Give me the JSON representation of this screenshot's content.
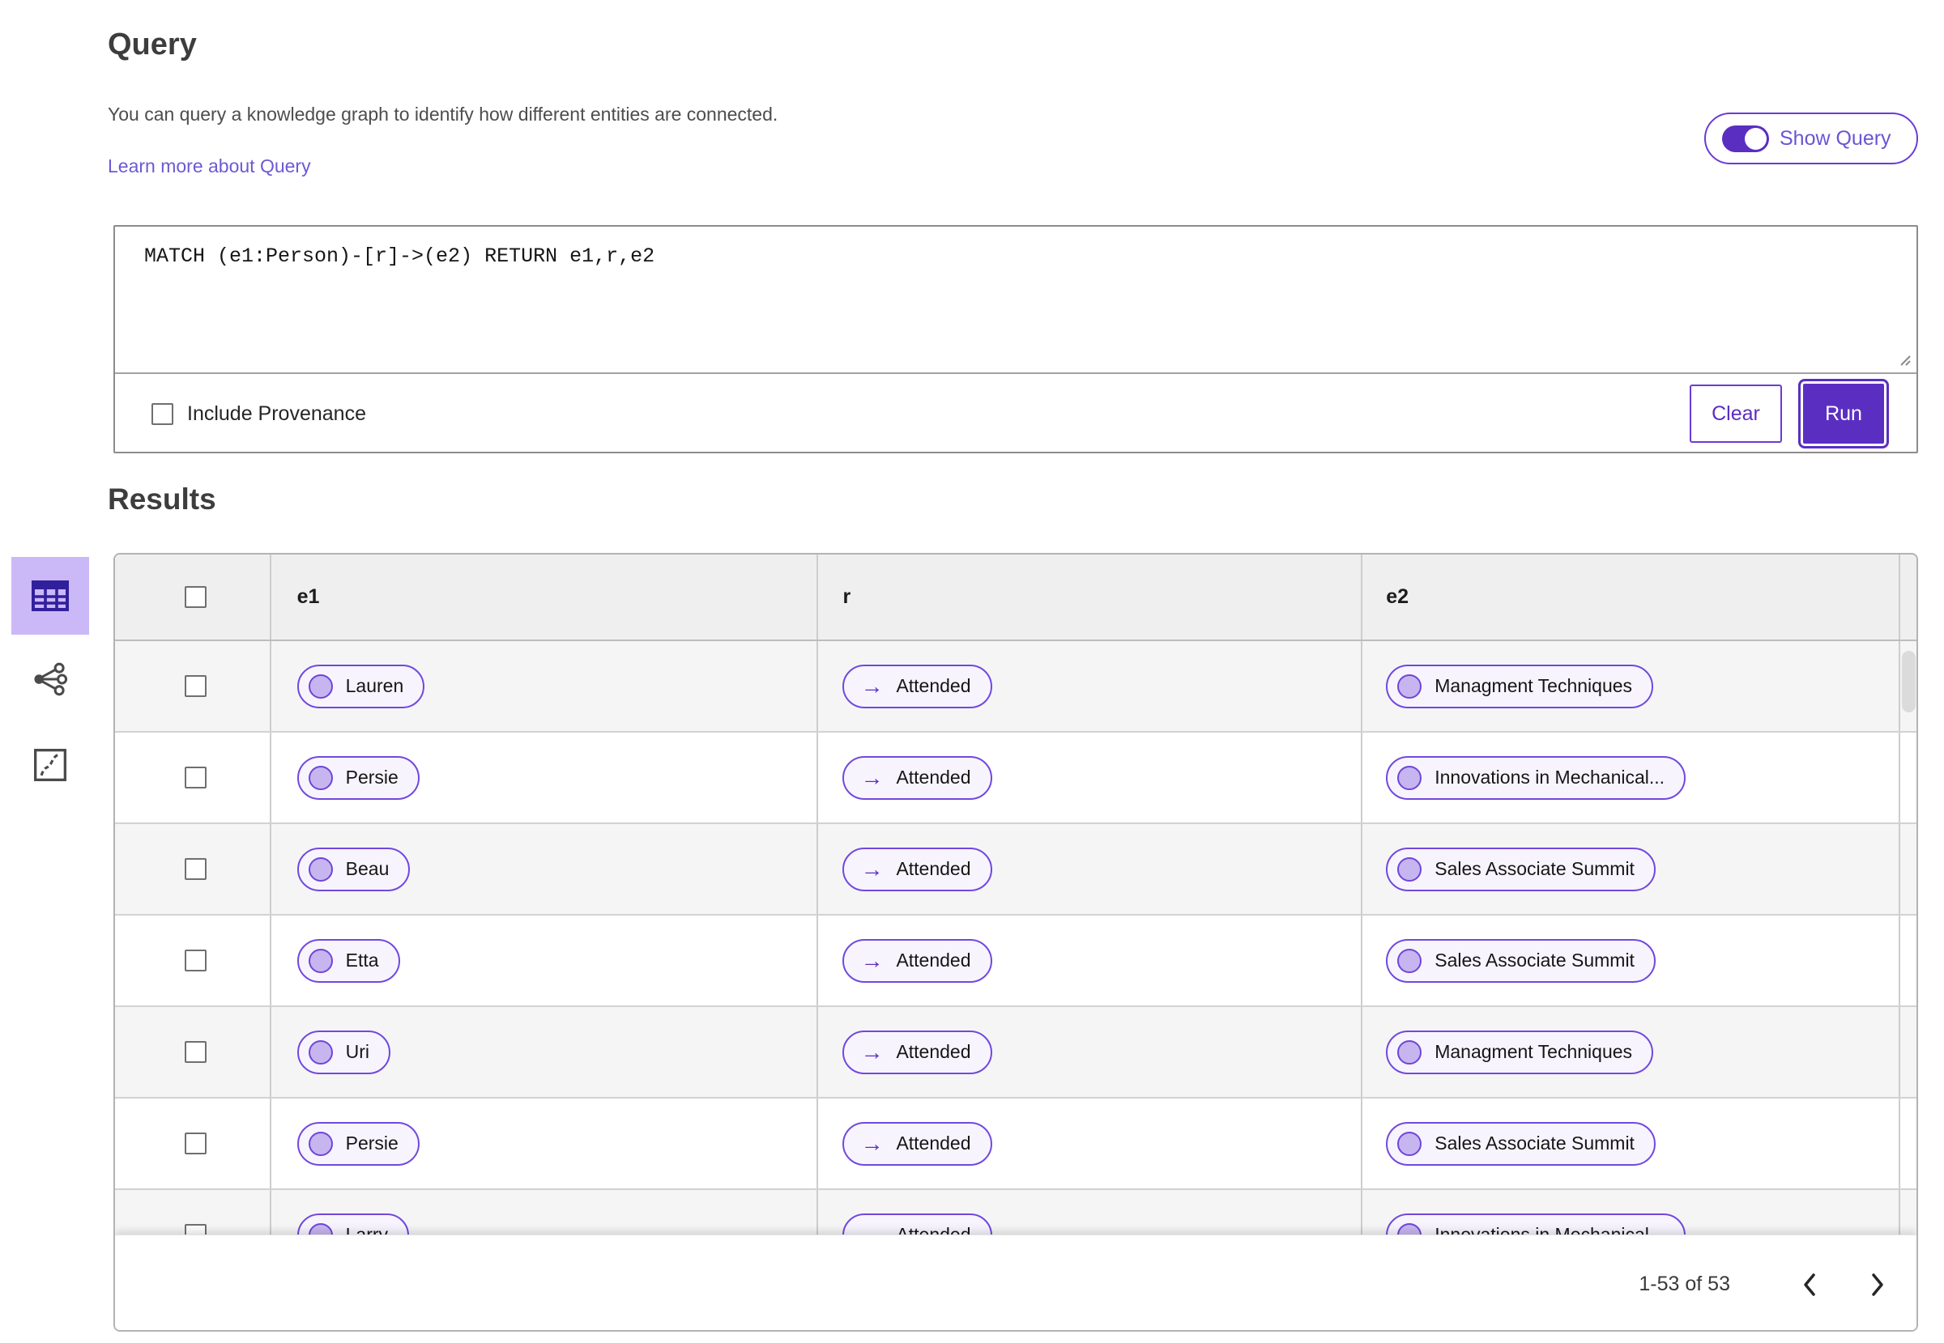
{
  "header": {
    "title": "Query",
    "description": "You can query a knowledge graph to identify how different entities are connected.",
    "learn_more": "Learn more about Query",
    "show_query_toggle": {
      "label": "Show Query",
      "state": "on"
    }
  },
  "query_editor": {
    "query_text": "MATCH (e1:Person)-[r]->(e2) RETURN e1,r,e2",
    "include_provenance_label": "Include Provenance",
    "include_provenance_checked": false,
    "clear_button": "Clear",
    "run_button": "Run"
  },
  "results": {
    "heading": "Results",
    "view_switcher": {
      "items": [
        {
          "icon": "table-view-icon",
          "selected": true
        },
        {
          "icon": "network-view-icon",
          "selected": false
        },
        {
          "icon": "chart-view-icon",
          "selected": false
        }
      ]
    },
    "table": {
      "columns": [
        "e1",
        "r",
        "e2"
      ],
      "relation_arrow": "→",
      "rows": [
        {
          "e1": "Lauren",
          "r": "Attended",
          "e2": "Managment Techniques"
        },
        {
          "e1": "Persie",
          "r": "Attended",
          "e2": "Innovations in Mechanical..."
        },
        {
          "e1": "Beau",
          "r": "Attended",
          "e2": "Sales Associate Summit"
        },
        {
          "e1": "Etta",
          "r": "Attended",
          "e2": "Sales Associate Summit"
        },
        {
          "e1": "Uri",
          "r": "Attended",
          "e2": "Managment Techniques"
        },
        {
          "e1": "Persie",
          "r": "Attended",
          "e2": "Sales Associate Summit"
        },
        {
          "e1": "Larry",
          "r": "Attended",
          "e2": "Innovations in Mechanical..."
        }
      ]
    },
    "pagination": {
      "range_label": "1-53 of 53",
      "prev_icon": "chevron-left",
      "next_icon": "chevron-right"
    }
  },
  "colors": {
    "accent": "#5b2ec2",
    "pill_border": "#7148dd",
    "pill_background": "#f7f4fe",
    "pill_node_fill": "#c7b5f0",
    "selected_view_background": "#cbb8f7",
    "link": "#6b5ad3",
    "table_header_background": "#efefef",
    "row_stripe_background": "#f5f5f6"
  }
}
